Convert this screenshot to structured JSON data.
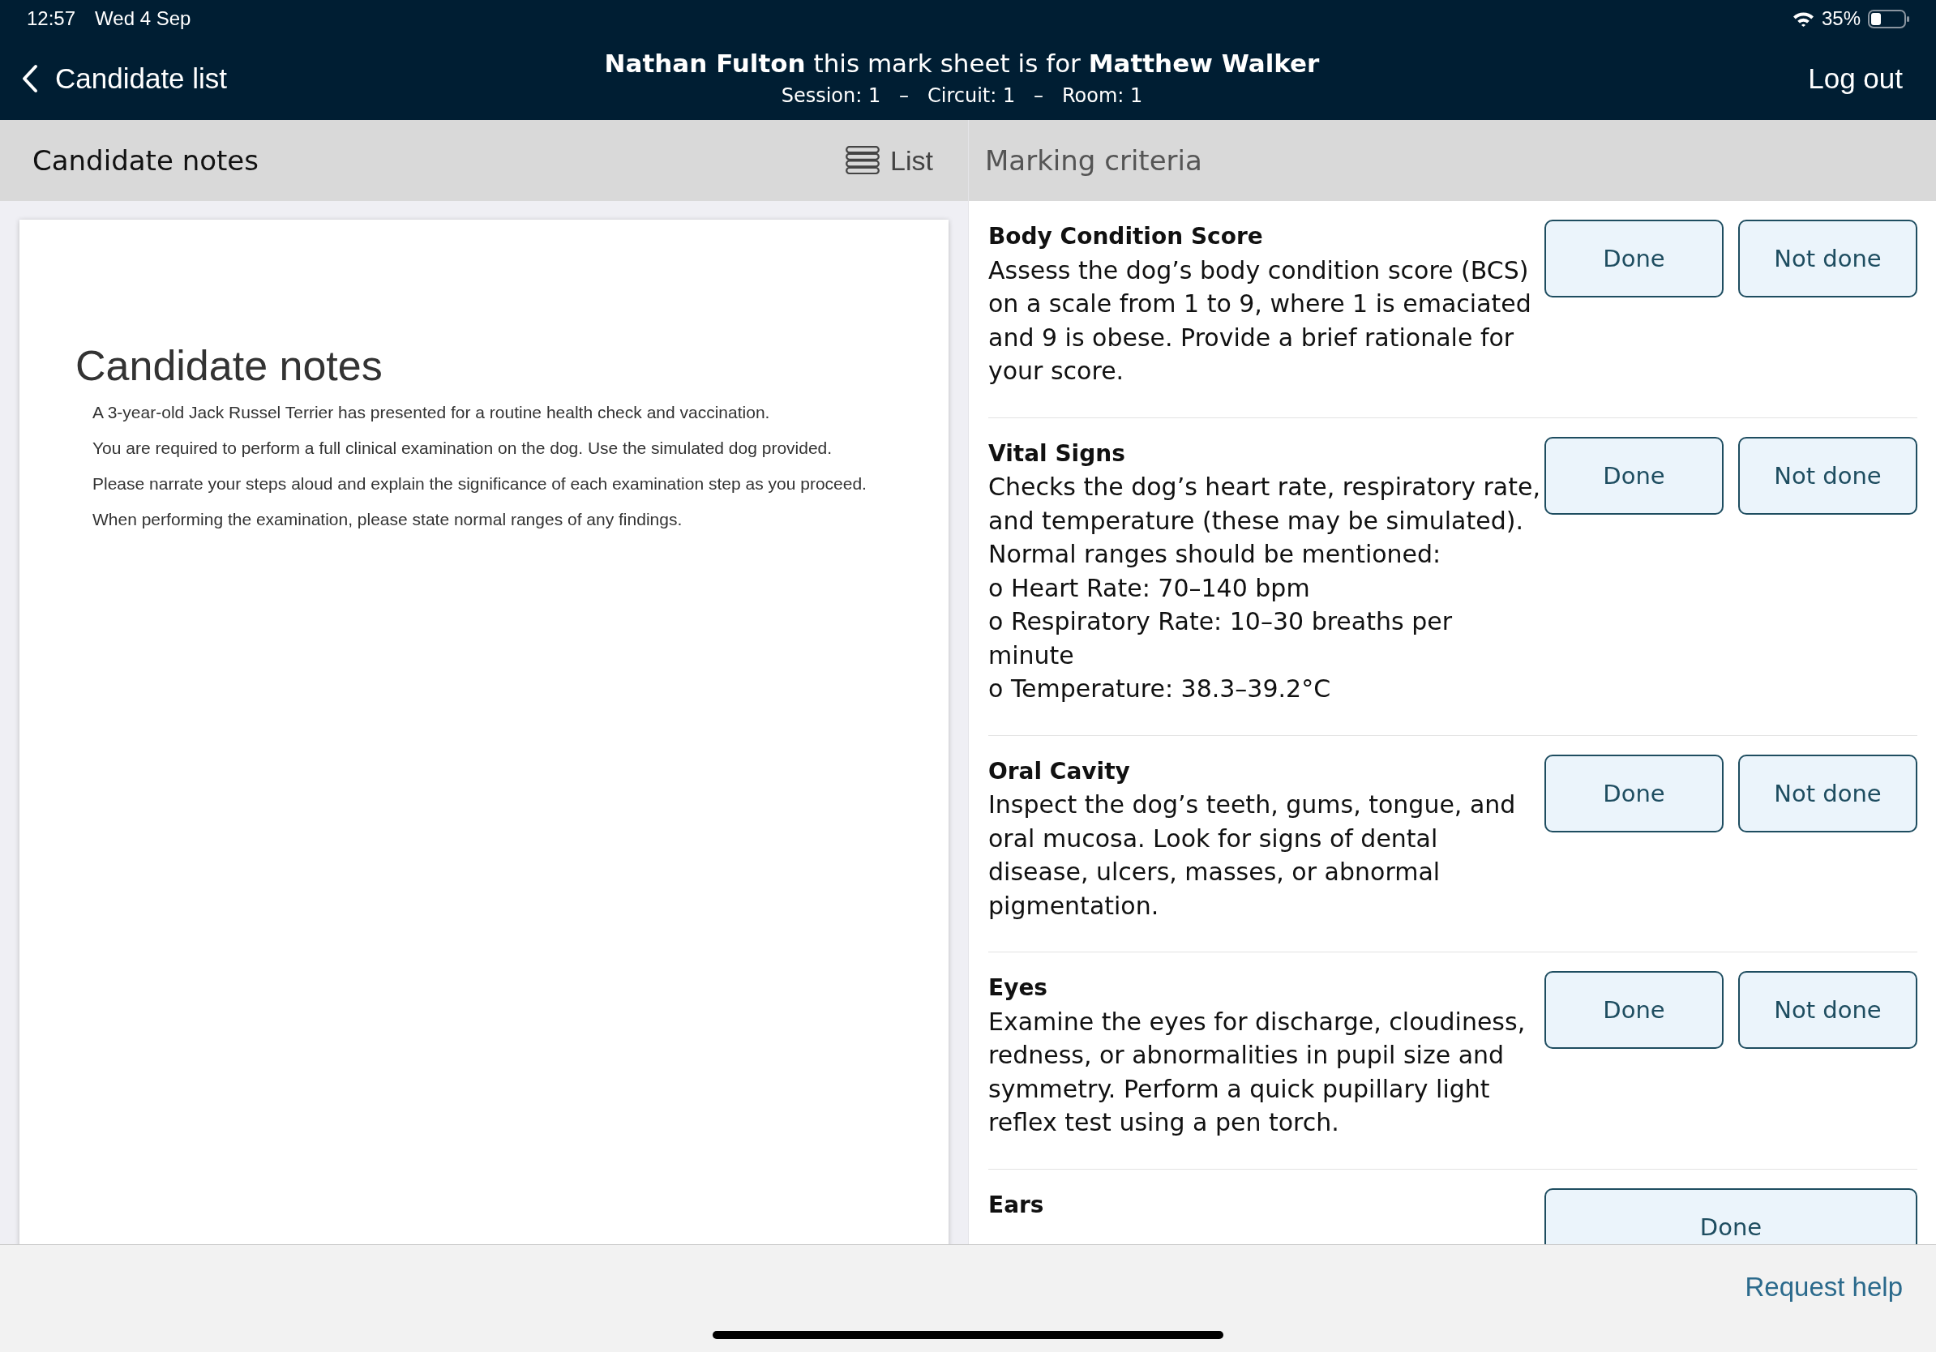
{
  "status_bar": {
    "time": "12:57",
    "date": "Wed 4 Sep",
    "battery": "35%"
  },
  "nav_bar": {
    "back": "Candidate list",
    "title": "**Nathan Fulton** this mark sheet is for **Matthew Walker**",
    "subtitle": "Session: 1   –   Circuit: 1   –   Room: 1",
    "logout": "Log out"
  },
  "notes_panel": {
    "header": "Candidate notes",
    "list_toggle": "List",
    "document": {
      "title": "Candidate notes",
      "paragraphs": [
        "A 3-year-old Jack Russel Terrier has presented for a routine health check and vaccination.",
        "You are required to perform a full clinical examination on the dog. Use the simulated dog provided.",
        "Please narrate your steps aloud and explain the significance of each examination step as you proceed.",
        "When performing the examination, please state normal ranges of any findings."
      ]
    }
  },
  "criteria_panel": {
    "header": "Marking criteria",
    "items": [
      {
        "title": "Body Condition Score",
        "description": "Assess the dog’s body condition score (BCS) on a scale from 1 to 9, where 1 is emaciated and 9 is obese. Provide a brief rationale for your score.",
        "buttons": [
          {
            "label": "Done",
            "selected": false
          },
          {
            "label": "Not done",
            "selected": false
          }
        ]
      },
      {
        "title": "Vital Signs",
        "description": "Checks the dog’s heart rate, respiratory rate, and temperature (these may be simulated).\nNormal ranges should be mentioned:\no Heart Rate: 70–140 bpm\no Respiratory Rate: 10–30 breaths per minute\no Temperature: 38.3–39.2°C",
        "buttons": [
          {
            "label": "Done",
            "selected": false
          },
          {
            "label": "Not done",
            "selected": false
          }
        ]
      },
      {
        "title": "Oral Cavity",
        "description": "Inspect the dog’s teeth, gums, tongue, and oral mucosa. Look for signs of dental disease, ulcers, masses, or abnormal pigmentation.",
        "buttons": [
          {
            "label": "Done",
            "selected": false
          },
          {
            "label": "Not done",
            "selected": false
          }
        ]
      },
      {
        "title": "Eyes",
        "description": "Examine the eyes for discharge, cloudiness, redness, or abnormalities in pupil size and symmetry. Perform a quick pupillary light reflex test using a pen torch.",
        "buttons": [
          {
            "label": "Done",
            "selected": false
          },
          {
            "label": "Not done",
            "selected": false
          }
        ]
      },
      {
        "title": "Ears",
        "buttons": [
          {
            "label": "Done",
            "selected": false
          }
        ]
      }
    ]
  },
  "footer": {
    "help_link": "Request help"
  }
}
